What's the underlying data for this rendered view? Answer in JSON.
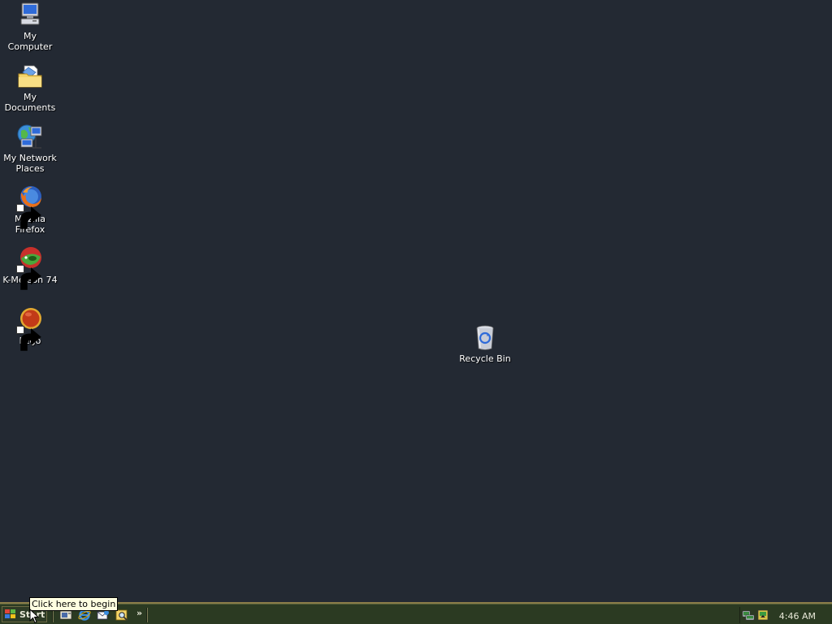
{
  "desktop": {
    "background_color": "#232933",
    "icons": [
      {
        "label": "My Computer",
        "icon": "my-computer-icon",
        "shortcut": false
      },
      {
        "label": "My Documents",
        "icon": "my-documents-icon",
        "shortcut": false
      },
      {
        "label": "My Network Places",
        "icon": "my-network-places-icon",
        "shortcut": false
      },
      {
        "label": "Mozilla Firefox",
        "icon": "firefox-icon",
        "shortcut": true
      },
      {
        "label": "K-Meleon 74",
        "icon": "k-meleon-icon",
        "shortcut": true
      },
      {
        "label": "Pego",
        "icon": "pego-icon",
        "shortcut": true
      },
      {
        "label": "Recycle Bin",
        "icon": "recycle-bin-icon",
        "shortcut": false
      }
    ]
  },
  "taskbar": {
    "start_label": "Start",
    "quick_launch": [
      {
        "icon": "show-desktop-icon"
      },
      {
        "icon": "internet-explorer-icon"
      },
      {
        "icon": "outlook-express-icon"
      },
      {
        "icon": "search-icon"
      }
    ],
    "quick_launch_more": "»",
    "tray_icons": [
      {
        "icon": "network-tray-icon"
      },
      {
        "icon": "safely-remove-tray-icon"
      }
    ],
    "clock": "4:46 AM"
  },
  "tooltip": {
    "text": "Click here to begin"
  },
  "colors": {
    "taskbar_bg": "#2b3a22",
    "taskbar_border": "#8b7d49",
    "tooltip_bg": "#ffffe1"
  }
}
